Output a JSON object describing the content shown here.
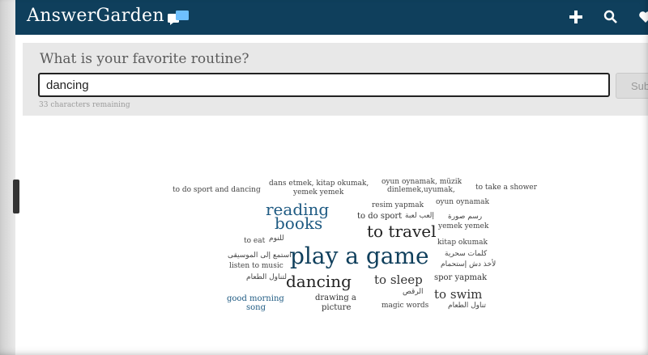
{
  "app": {
    "title": "AnswerGarden"
  },
  "nav": {
    "add_icon": "plus-icon",
    "search_icon": "search-icon",
    "heart_icon": "heart-icon"
  },
  "question": {
    "text": "What is your favorite routine?",
    "input_value": "dancing",
    "submit_label": "Sub",
    "remaining": "33 characters remaining"
  },
  "cloud": {
    "w1": "to do sport and dancing",
    "w2": "dans etmek, kitap okumak,",
    "w3": "yemek yemek",
    "w4": "oyun oynamak, müzik",
    "w5": "dinlemek,uyumak,",
    "w6": "to take a shower",
    "w7": "oyun oynamak",
    "w8": "resim yapmak",
    "w9": "reading",
    "w10": "books",
    "w11": "to do sport",
    "w12": "إلعب لعبة",
    "w13": "رسم صورة",
    "w14": "yemek yemek",
    "w15": "to travel",
    "w16": "to eat",
    "w17": "للنوم",
    "w18": "kitap okumak",
    "w19": "استمع إلى الموسيقى",
    "w20": "play a game",
    "w21": "كلمات سحرية",
    "w22": "listen to music",
    "w23": "لأخذ دش إستحمام",
    "w24": "لتناول الطعام",
    "w25": "dancing",
    "w26": "to sleep",
    "w27": "spor yapmak",
    "w28": "الرقص",
    "w29": "good morning",
    "w30": "song",
    "w31": "drawing a",
    "w32": "picture",
    "w33": "magic words",
    "w34": "to swim",
    "w35": "تناول الطعام"
  }
}
